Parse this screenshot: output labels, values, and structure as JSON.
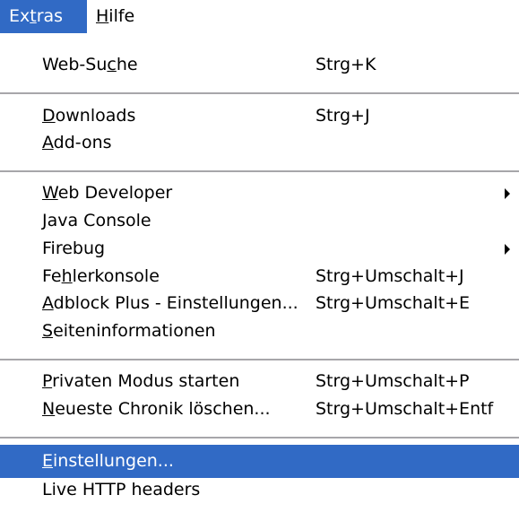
{
  "menubar": {
    "items": [
      {
        "label": "Extras",
        "accesskey": "t",
        "active": true
      },
      {
        "label": "Hilfe",
        "accesskey": "H",
        "active": false
      }
    ]
  },
  "menu": {
    "items": [
      {
        "label": "Web-Suche",
        "accesskey_index": 6,
        "shortcut": "Strg+K"
      },
      {
        "label": "Downloads",
        "accesskey_index": 0,
        "shortcut": "Strg+J"
      },
      {
        "label": "Add-ons",
        "accesskey_index": 0,
        "shortcut": ""
      },
      {
        "label": "Web Developer",
        "accesskey_index": 0,
        "shortcut": "",
        "submenu": true
      },
      {
        "label": "Java Console",
        "accesskey_index": 0,
        "shortcut": ""
      },
      {
        "label": "Firebug",
        "accesskey_index": -1,
        "shortcut": "",
        "submenu": true
      },
      {
        "label": "Fehlerkonsole",
        "accesskey_index": 2,
        "shortcut": "Strg+Umschalt+J"
      },
      {
        "label": "Adblock Plus - Einstellungen...",
        "accesskey_index": 0,
        "shortcut": "Strg+Umschalt+E"
      },
      {
        "label": "Seiteninformationen",
        "accesskey_index": 0,
        "shortcut": ""
      },
      {
        "label": "Privaten Modus starten",
        "accesskey_index": 0,
        "shortcut": "Strg+Umschalt+P"
      },
      {
        "label": "Neueste Chronik löschen...",
        "accesskey_index": 0,
        "shortcut": "Strg+Umschalt+Entf"
      },
      {
        "label": "Einstellungen...",
        "accesskey_index": 0,
        "shortcut": "",
        "highlighted": true
      },
      {
        "label": "Live HTTP headers",
        "accesskey_index": -1,
        "shortcut": ""
      }
    ]
  },
  "colors": {
    "highlight": "#316ac5",
    "separator": "#a7a6aa"
  },
  "icons": {
    "submenu": "submenu-arrow-icon"
  }
}
